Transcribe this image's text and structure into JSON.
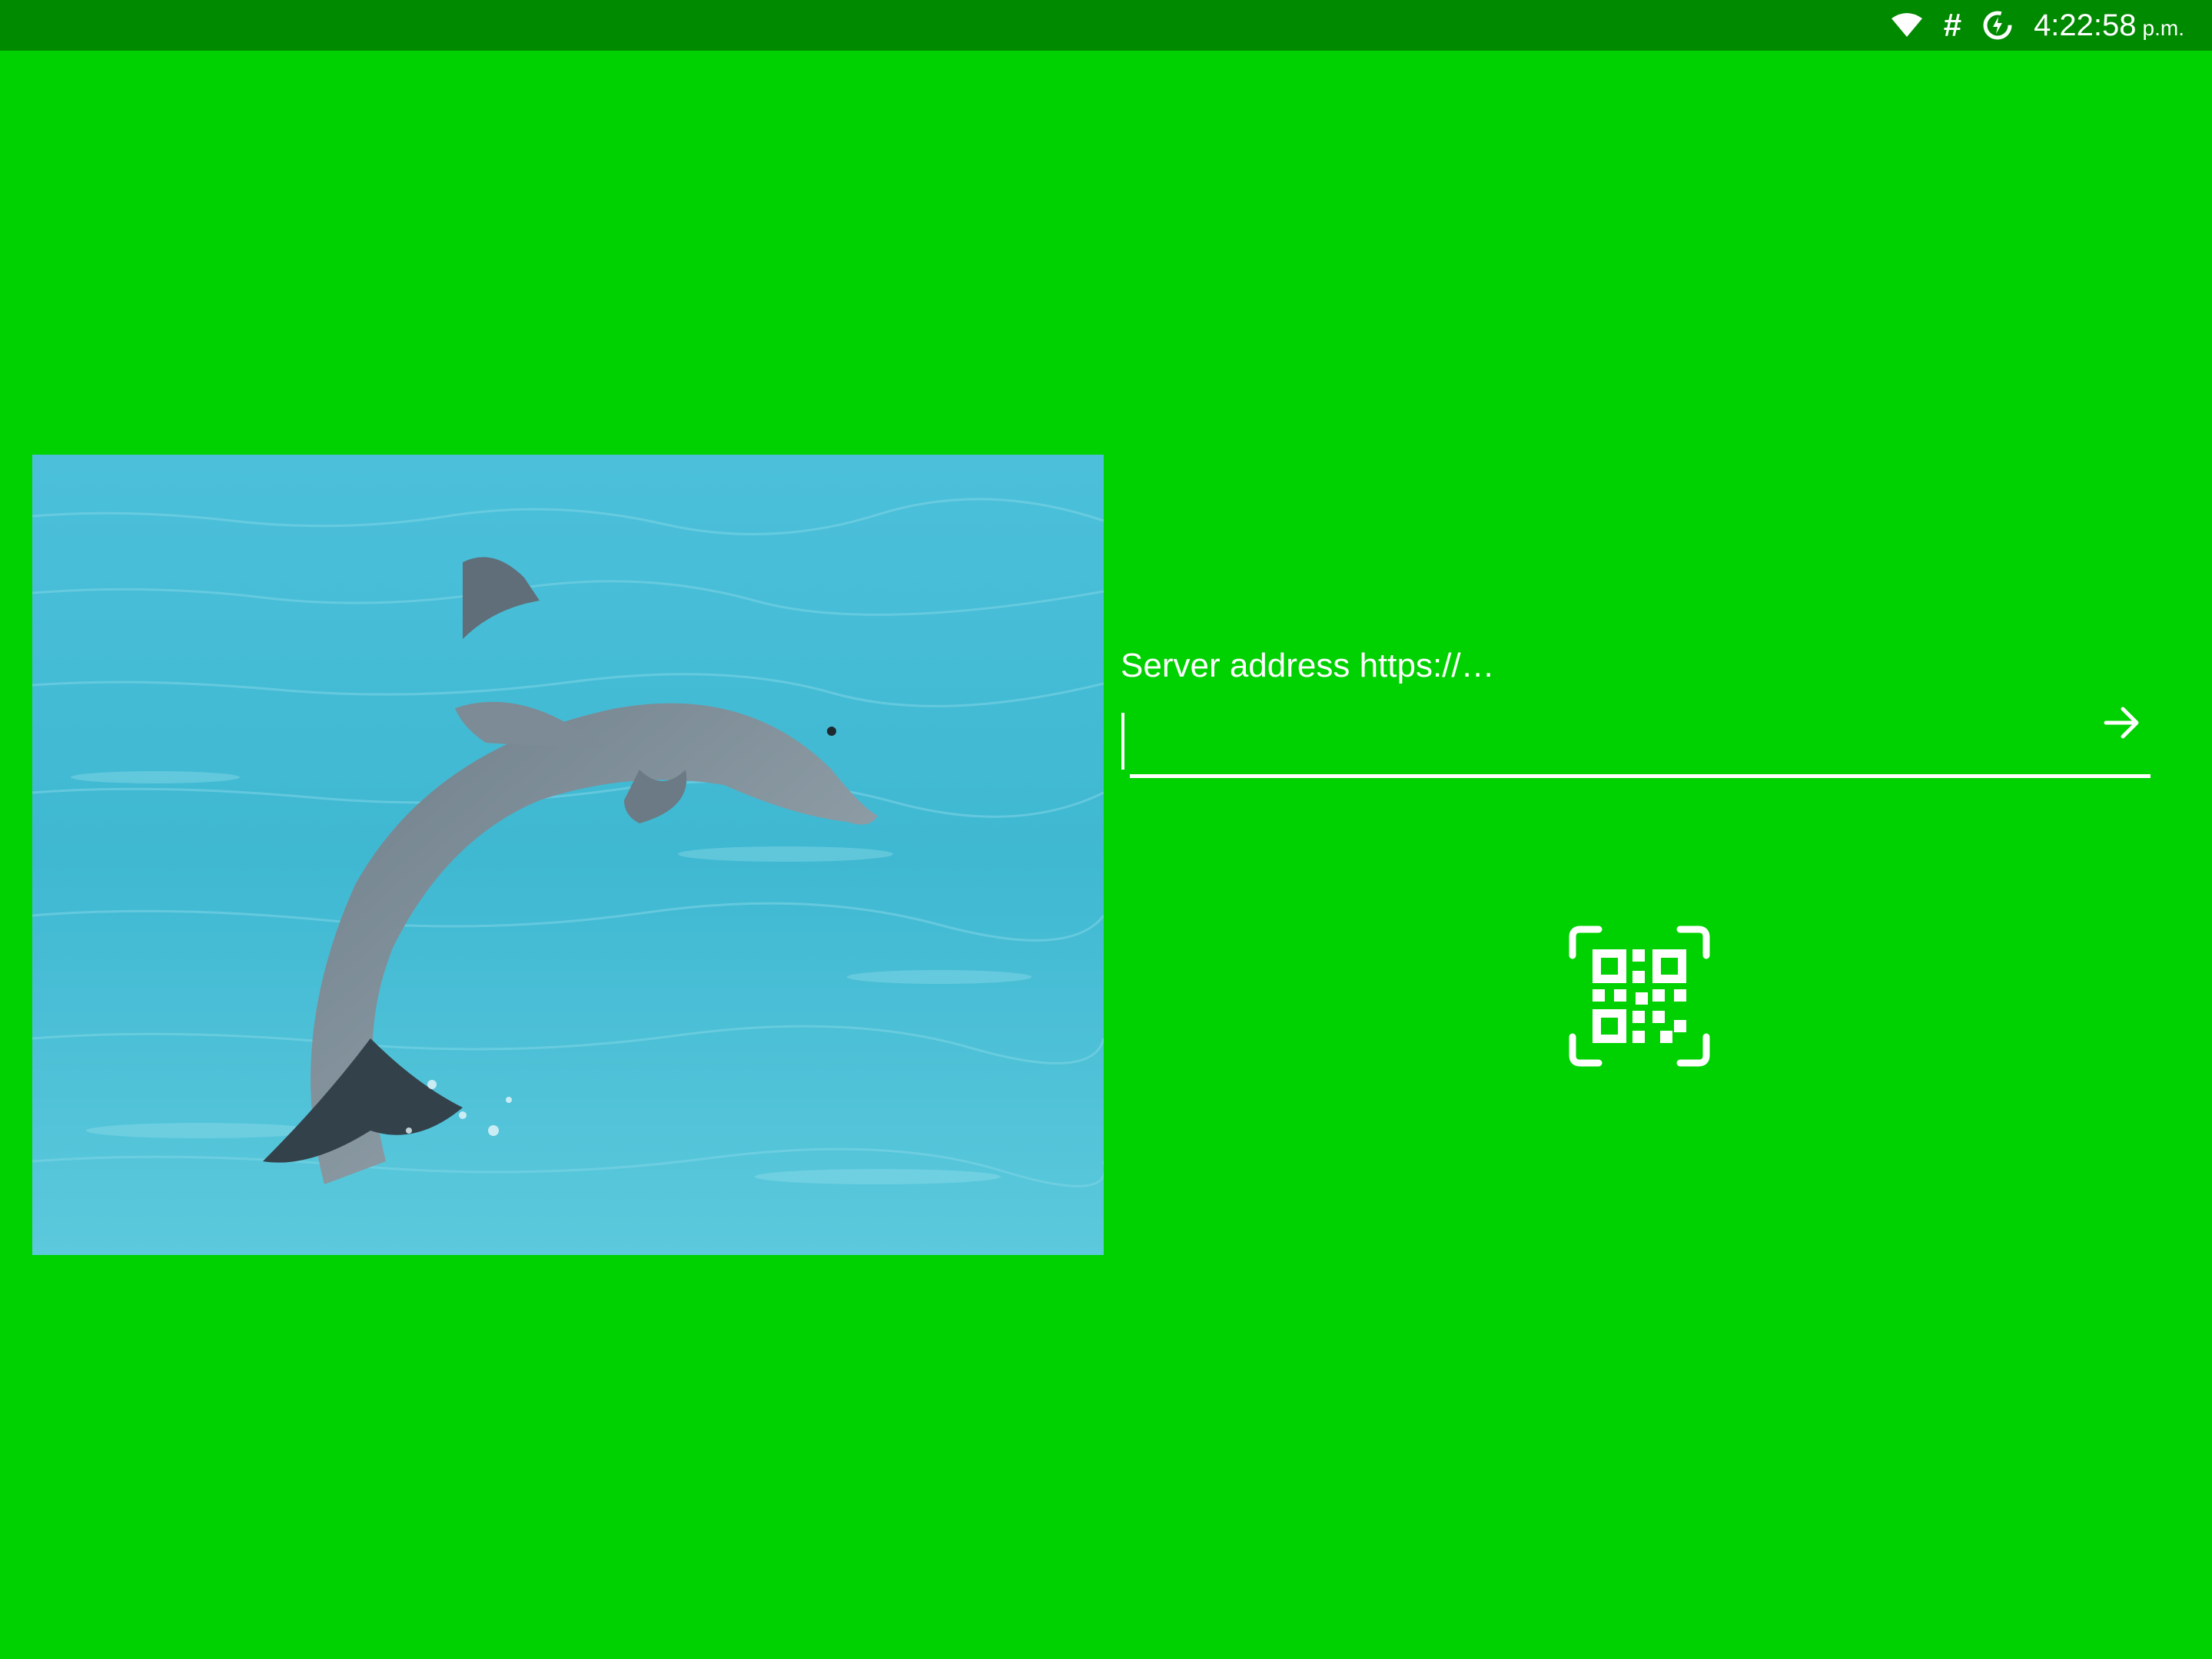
{
  "statusbar": {
    "clock_time": "4:22:58",
    "clock_ampm": "p.m.",
    "hash_symbol": "#",
    "icons": [
      "wifi-icon",
      "hash-icon",
      "data-saver-icon"
    ]
  },
  "image": {
    "subject": "dolphin-photo"
  },
  "server": {
    "label": "Server address https://…",
    "value": ""
  },
  "actions": {
    "go_icon": "arrow-right-icon",
    "scan_icon": "qr-scan-icon"
  },
  "colors": {
    "background": "#00d100",
    "statusbar": "#008a00",
    "foreground": "#ffffff"
  }
}
